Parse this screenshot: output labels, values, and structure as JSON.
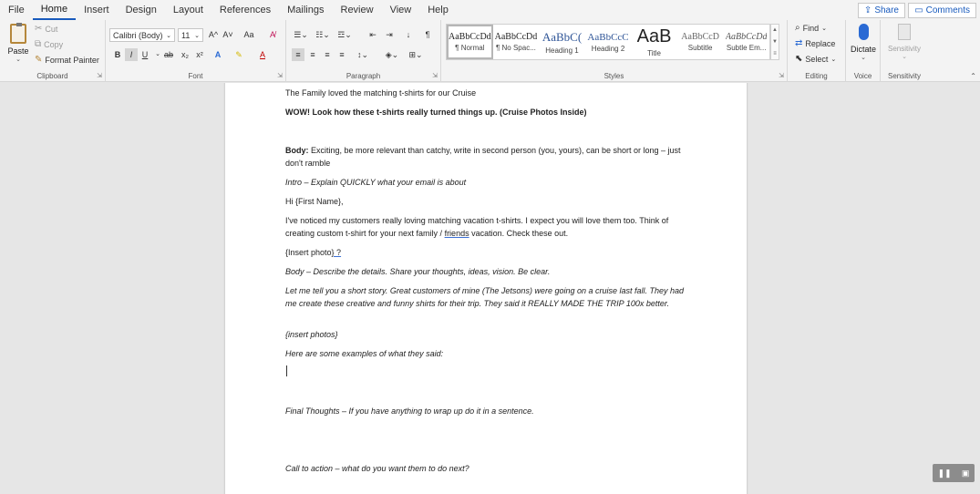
{
  "menu": {
    "items": [
      "File",
      "Home",
      "Insert",
      "Design",
      "Layout",
      "References",
      "Mailings",
      "Review",
      "View",
      "Help"
    ],
    "active": "Home",
    "share_label": "Share",
    "comments_label": "Comments"
  },
  "clipboard": {
    "paste_label": "Paste",
    "cut_label": "Cut",
    "copy_label": "Copy",
    "format_painter_label": "Format Painter",
    "group_label": "Clipboard"
  },
  "font": {
    "font_name": "Calibri (Body)",
    "font_size": "11",
    "grow_label": "A^",
    "shrink_label": "A˅",
    "case_label": "Aa",
    "bold_label": "B",
    "italic_label": "I",
    "underline_label": "U",
    "strike_label": "ab",
    "subscript_label": "x₂",
    "superscript_label": "x²",
    "group_label": "Font"
  },
  "paragraph": {
    "group_label": "Paragraph"
  },
  "styles": {
    "tiles": [
      {
        "preview": "AaBbCcDd",
        "name": "¶ Normal"
      },
      {
        "preview": "AaBbCcDd",
        "name": "¶ No Spac..."
      },
      {
        "preview": "AaBbC(",
        "name": "Heading 1"
      },
      {
        "preview": "AaBbCcC",
        "name": "Heading 2"
      },
      {
        "preview": "AaB",
        "name": "Title"
      },
      {
        "preview": "AaBbCcD",
        "name": "Subtitle"
      },
      {
        "preview": "AaBbCcDd",
        "name": "Subtle Em..."
      }
    ],
    "group_label": "Styles"
  },
  "editing": {
    "find_label": "Find",
    "replace_label": "Replace",
    "select_label": "Select",
    "group_label": "Editing"
  },
  "voice": {
    "dictate_label": "Dictate",
    "group_label": "Voice"
  },
  "sensitivity": {
    "button_label": "Sensitivity",
    "group_label": "Sensitivity"
  },
  "document": {
    "p1": "The Family loved the matching t-shirts for our Cruise",
    "p2": "WOW! Look how these t-shirts really turned things up. (Cruise Photos Inside)",
    "p3_bold": "Body:",
    "p3_rest": " Exciting, be more relevant than catchy, write in second person (you, yours), can be short or long – just don't ramble",
    "p4": "Intro – Explain QUICKLY what your email is about",
    "p5": "Hi {First Name},",
    "p6_a": "I've noticed my customers really loving matching vacation t-shirts. I expect you will love them too. Think of creating custom t-shirt for your next family / ",
    "p6_link": "friends",
    "p6_b": " vacation. Check these out.",
    "p7_a": "{Insert photo",
    "p7_b": "} ?",
    "p8": "Body – Describe the details. Share your thoughts, ideas, vision. Be clear.",
    "p9": "Let me tell you a short story. Great customers of mine (The Jetsons) were going on a cruise last fall. They had me create these creative and funny shirts for their trip. They said it REALLY MADE THE TRIP 100x better.",
    "p10": "{insert photos}",
    "p11": "Here are some examples of what they said:",
    "p12": "Final Thoughts – If you have anything to wrap up do it in a sentence.",
    "p13": "Call to action – what do you want them to do next?"
  }
}
